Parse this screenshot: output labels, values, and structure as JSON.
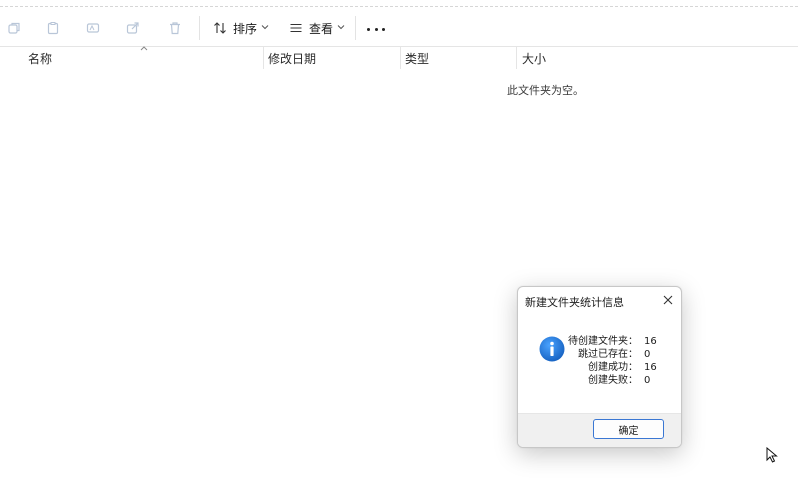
{
  "toolbar": {
    "sort_label": "排序",
    "view_label": "查看",
    "icons": [
      "copy-icon",
      "paste-icon",
      "rename-icon",
      "share-icon",
      "delete-icon",
      "sort-icon",
      "view-icon",
      "more-icon"
    ]
  },
  "columns": {
    "name": "名称",
    "modified": "修改日期",
    "type": "类型",
    "size": "大小"
  },
  "empty_message": "此文件夹为空。",
  "dialog": {
    "title": "新建文件夹统计信息",
    "stats": [
      {
        "label": "待创建文件夹：",
        "value": "16"
      },
      {
        "label": "跳过已存在：",
        "value": "0"
      },
      {
        "label": "创建成功：",
        "value": "16"
      },
      {
        "label": "创建失败：",
        "value": "0"
      }
    ],
    "ok_label": "确定"
  },
  "colors": {
    "accent": "#3a77d3",
    "info_icon": "#1f79d6",
    "disabled_icon": "#b9c6d8"
  }
}
